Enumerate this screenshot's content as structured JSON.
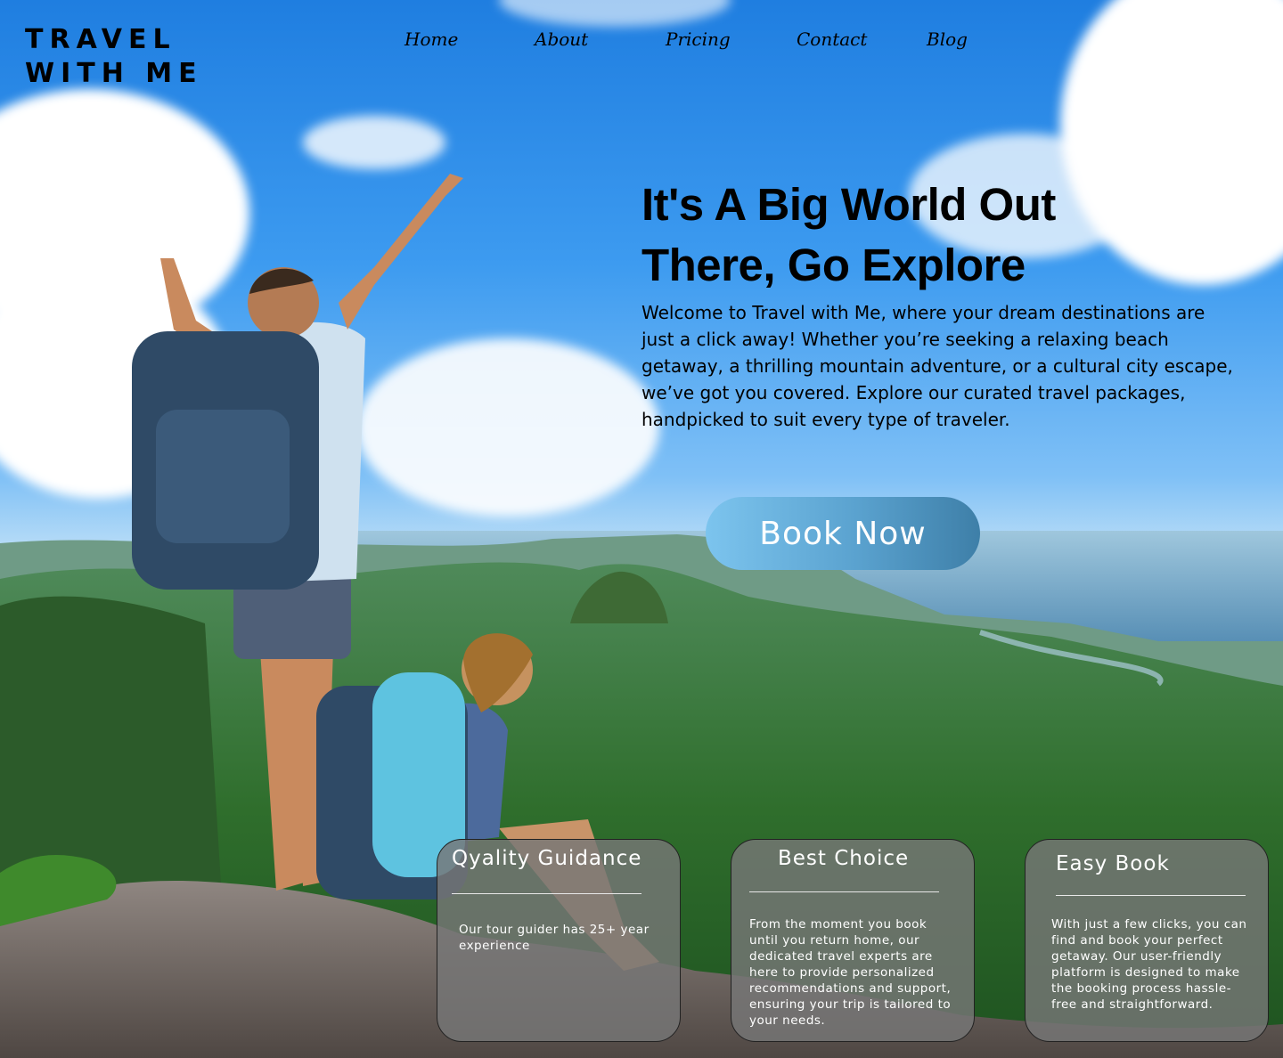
{
  "brand": {
    "line1": "TRAVEL",
    "line2": "WITH ME"
  },
  "nav": {
    "items": [
      {
        "label": "Home"
      },
      {
        "label": "About"
      },
      {
        "label": "Pricing"
      },
      {
        "label": "Contact"
      },
      {
        "label": "Blog"
      }
    ]
  },
  "hero": {
    "title_line1": "It's A Big World Out",
    "title_line2": "There, Go  Explore",
    "text": "Welcome to  Travel with Me, where your dream destinations are just a click away! Whether you’re seeking a relaxing beach getaway, a thrilling mountain adventure, or a cultural city escape, we’ve got you covered. Explore our curated travel packages, handpicked to suit every type of traveler.",
    "cta_label": "Book Now"
  },
  "features": [
    {
      "title": "Qyality Guidance",
      "text": "Our tour guider has 25+ year experience"
    },
    {
      "title": "Best Choice",
      "text": "From the moment you book until you return home, our dedicated travel experts are here to provide personalized recommendations and support, ensuring your trip is tailored to your needs."
    },
    {
      "title": "Easy Book",
      "text": "With just a few clicks, you can find and book your perfect getaway. Our user-friendly platform is designed to make the booking process hassle-free and straightforward."
    }
  ],
  "colors": {
    "sky": "#3d9bf0",
    "cta_gradient_start": "#7cc4ee",
    "cta_gradient_end": "#3e7fa8",
    "card_background": "#767676",
    "text_dark": "#000000"
  },
  "background_image": "hikers-on-mountain-summit-overlooking-valley-and-sea"
}
